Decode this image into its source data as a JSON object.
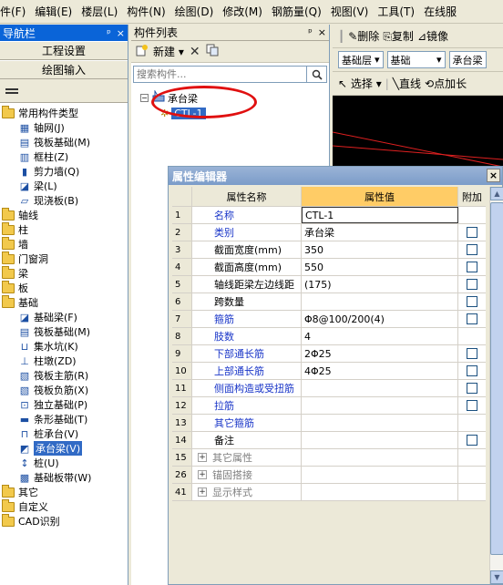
{
  "menubar": [
    "件(F)",
    "编辑(E)",
    "楼层(L)",
    "构件(N)",
    "绘图(D)",
    "修改(M)",
    "钢筋量(Q)",
    "视图(V)",
    "工具(T)",
    "在线服"
  ],
  "nav": {
    "title": "导航栏",
    "pin": "ᵖ",
    "close": "×",
    "buttons": [
      "工程设置",
      "绘图输入"
    ],
    "tree": [
      {
        "label": "常用构件类型",
        "level": 0,
        "type": "folder"
      },
      {
        "label": "轴网(J)",
        "level": 1,
        "icon": "grid-icon"
      },
      {
        "label": "筏板基础(M)",
        "level": 1,
        "icon": "raft-icon"
      },
      {
        "label": "框柱(Z)",
        "level": 1,
        "icon": "column-icon"
      },
      {
        "label": "剪力墙(Q)",
        "level": 1,
        "icon": "wall-icon"
      },
      {
        "label": "梁(L)",
        "level": 1,
        "icon": "beam-icon"
      },
      {
        "label": "现浇板(B)",
        "level": 1,
        "icon": "slab-icon"
      },
      {
        "label": "轴线",
        "level": 0,
        "type": "folder"
      },
      {
        "label": "柱",
        "level": 0,
        "type": "folder"
      },
      {
        "label": "墙",
        "level": 0,
        "type": "folder"
      },
      {
        "label": "门窗洞",
        "level": 0,
        "type": "folder"
      },
      {
        "label": "梁",
        "level": 0,
        "type": "folder"
      },
      {
        "label": "板",
        "level": 0,
        "type": "folder"
      },
      {
        "label": "基础",
        "level": 0,
        "type": "folder"
      },
      {
        "label": "基础梁(F)",
        "level": 1,
        "icon": "beam-icon"
      },
      {
        "label": "筏板基础(M)",
        "level": 1,
        "icon": "raft-icon"
      },
      {
        "label": "集水坑(K)",
        "level": 1,
        "icon": "pit-icon"
      },
      {
        "label": "柱墩(ZD)",
        "level": 1,
        "icon": "pier-icon"
      },
      {
        "label": "筏板主筋(R)",
        "level": 1,
        "icon": "rebar-icon"
      },
      {
        "label": "筏板负筋(X)",
        "level": 1,
        "icon": "rebar-icon"
      },
      {
        "label": "独立基础(P)",
        "level": 1,
        "icon": "footing-icon"
      },
      {
        "label": "条形基础(T)",
        "level": 1,
        "icon": "strip-icon"
      },
      {
        "label": "桩承台(V)",
        "level": 1,
        "icon": "pilecap-icon"
      },
      {
        "label": "承台梁(V)",
        "level": 1,
        "icon": "capbeam-icon",
        "selected": true
      },
      {
        "label": "桩(U)",
        "level": 1,
        "icon": "pile-icon"
      },
      {
        "label": "基础板带(W)",
        "level": 1,
        "icon": "band-icon"
      },
      {
        "label": "其它",
        "level": 0,
        "type": "folder"
      },
      {
        "label": "自定义",
        "level": 0,
        "type": "folder"
      },
      {
        "label": "CAD识别",
        "level": 0,
        "type": "folder"
      }
    ]
  },
  "clist": {
    "title": "构件列表",
    "pin": "ᵖ",
    "close": "×",
    "new_label": "新建",
    "search_placeholder": "搜索构件...",
    "tree": {
      "parent": "承台梁",
      "child": "CTL-1"
    }
  },
  "draw": {
    "toolbar1": [
      "删除",
      "复制",
      "镜像"
    ],
    "combo1": "基础层",
    "combo2": "基础",
    "combo3": "承台梁",
    "select_label": "选择",
    "line_label": "直线",
    "point_label": "点加长"
  },
  "prop_editor": {
    "title": "属性编辑器",
    "close": "×",
    "headers": {
      "name": "属性名称",
      "value": "属性值",
      "extra": "附加"
    },
    "rows": [
      {
        "n": "1",
        "name": "名称",
        "value": "CTL-1",
        "blue": true,
        "cb": false
      },
      {
        "n": "2",
        "name": "类别",
        "value": "承台梁",
        "blue": true,
        "cb": true
      },
      {
        "n": "3",
        "name": "截面宽度(mm)",
        "value": "350",
        "blue": false,
        "cb": true
      },
      {
        "n": "4",
        "name": "截面高度(mm)",
        "value": "550",
        "blue": false,
        "cb": true
      },
      {
        "n": "5",
        "name": "轴线距梁左边线距",
        "value": "(175)",
        "blue": false,
        "cb": true
      },
      {
        "n": "6",
        "name": "跨数量",
        "value": "",
        "blue": false,
        "cb": true
      },
      {
        "n": "7",
        "name": "箍筋",
        "value": "Φ8@100/200(4)",
        "blue": true,
        "cb": true
      },
      {
        "n": "8",
        "name": "肢数",
        "value": "4",
        "blue": true,
        "cb": false
      },
      {
        "n": "9",
        "name": "下部通长筋",
        "value": "2Φ25",
        "blue": true,
        "cb": true
      },
      {
        "n": "10",
        "name": "上部通长筋",
        "value": "4Φ25",
        "blue": true,
        "cb": true
      },
      {
        "n": "11",
        "name": "侧面构造或受扭筋",
        "value": "",
        "blue": true,
        "cb": true
      },
      {
        "n": "12",
        "name": "拉筋",
        "value": "",
        "blue": true,
        "cb": true
      },
      {
        "n": "13",
        "name": "其它箍筋",
        "value": "",
        "blue": true,
        "cb": false
      },
      {
        "n": "14",
        "name": "备注",
        "value": "",
        "blue": false,
        "cb": true
      }
    ],
    "groups": [
      {
        "n": "15",
        "name": "其它属性"
      },
      {
        "n": "26",
        "name": "锚固搭接"
      },
      {
        "n": "41",
        "name": "显示样式"
      }
    ]
  }
}
